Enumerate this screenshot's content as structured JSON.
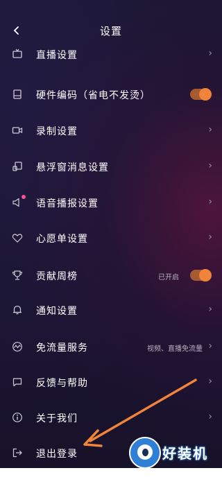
{
  "header": {
    "back_icon": "chevron-left-icon",
    "title": "设置"
  },
  "items": [
    {
      "key": "live",
      "label": "直播设置",
      "icon": "tv-icon",
      "trailing": "chevron"
    },
    {
      "key": "hw",
      "label": "硬件编码（省电不发烫）",
      "icon": "device-icon",
      "trailing": "toggle",
      "toggle_on": true
    },
    {
      "key": "record",
      "label": "录制设置",
      "icon": "video-camera-icon",
      "trailing": "chevron"
    },
    {
      "key": "float",
      "label": "悬浮窗消息设置",
      "icon": "floating-window-icon",
      "trailing": "chevron"
    },
    {
      "key": "voice",
      "label": "语音播报设置",
      "icon": "speaker-icon",
      "trailing": "chevron",
      "badge_dot": true
    },
    {
      "key": "wish",
      "label": "心愿单设置",
      "icon": "heart-icon",
      "trailing": "chevron"
    },
    {
      "key": "rank",
      "label": "贡献周榜",
      "icon": "trophy-icon",
      "trailing": "toggle",
      "hint": "已开启",
      "toggle_on": true
    },
    {
      "key": "notify",
      "label": "通知设置",
      "icon": "bell-icon",
      "trailing": "chevron"
    },
    {
      "key": "data",
      "label": "免流量服务",
      "icon": "wave-icon",
      "trailing": "chevron",
      "hint": "视频、直播免流量"
    },
    {
      "key": "feedback",
      "label": "反馈与帮助",
      "icon": "chat-bubble-icon",
      "trailing": "chevron"
    },
    {
      "key": "about",
      "label": "关于我们",
      "icon": "info-icon",
      "trailing": "chevron"
    },
    {
      "key": "logout",
      "label": "退出登录",
      "icon": "logout-icon",
      "trailing": "none"
    }
  ],
  "chevron_glyph": "›",
  "watermark": {
    "text": "好装机"
  },
  "colors": {
    "accent": "#f0843a",
    "toggle_track": "#a65a2f",
    "badge": "#ff4f9a",
    "arrow": "#f0843a"
  }
}
